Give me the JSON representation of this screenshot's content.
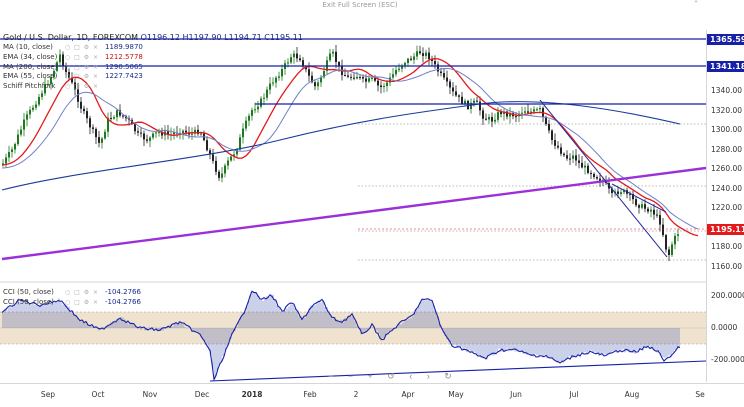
{
  "toolbar": {
    "exit_fullscreen": "Exit Full Screen (ESC)",
    "caret": "˅"
  },
  "symbol": {
    "name": "Gold / U.S. Dollar, 1D, FOREXCOM",
    "ohlc": "O1196.12  H1197.90  L1194.71  C1195.11"
  },
  "legend": [
    {
      "label": "MA (10, close)",
      "value": "1189.9870",
      "color": "#1a2a8a"
    },
    {
      "label": "EMA (34, close)",
      "value": "1212.5778",
      "color": "#d11111"
    },
    {
      "label": "MA (200, close)",
      "value": "1290.5065",
      "color": "#1a2a8a"
    },
    {
      "label": "EMA (55, close)",
      "value": "1227.7423",
      "color": "#1a2a8a"
    },
    {
      "label": "Schiff Pitchfork",
      "value": "",
      "color": "#aaaaaa"
    }
  ],
  "cci_legend": [
    {
      "label": "CCI (50, close)",
      "value": "-104.2766"
    },
    {
      "label": "CCI (50, close)",
      "value": "-104.2766"
    }
  ],
  "price_axis": {
    "ticks": [
      "1340.00",
      "1320.00",
      "1300.00",
      "1280.00",
      "1260.00",
      "1240.00",
      "1220.00",
      "1200.00",
      "1180.00",
      "1160.00"
    ],
    "tags": [
      {
        "text": "1365.59",
        "color": "blue"
      },
      {
        "text": "1341.18",
        "color": "blue"
      },
      {
        "text": "1195.11",
        "color": "red"
      }
    ]
  },
  "cci_axis": {
    "ticks": [
      "200.0000",
      "0.0000",
      "-200.0000"
    ]
  },
  "time_axis": {
    "ticks": [
      {
        "label": "Sep",
        "bold": false
      },
      {
        "label": "Oct",
        "bold": false
      },
      {
        "label": "Nov",
        "bold": false
      },
      {
        "label": "Dec",
        "bold": false
      },
      {
        "label": "2018",
        "bold": true
      },
      {
        "label": "Feb",
        "bold": false
      },
      {
        "label": "2",
        "bold": false
      },
      {
        "label": "Apr",
        "bold": false
      },
      {
        "label": "May",
        "bold": false
      },
      {
        "label": "Jun",
        "bold": false
      },
      {
        "label": "Jul",
        "bold": false
      },
      {
        "label": "Aug",
        "bold": false
      },
      {
        "label": "Se",
        "bold": false
      }
    ]
  },
  "nav_controls": "− − + ↺ ‹ › ↻",
  "colors": {
    "candle_up": "#1e7a1e",
    "candle_down": "#222222",
    "ema34": "#e31a1c",
    "ma200": "#1a3a9a",
    "ema55": "#7080c8",
    "trend_purple": "#9b30d9",
    "hline": "#1621a8",
    "cci_band": "#efe3cf",
    "cci_line": "#1621a8"
  }
}
